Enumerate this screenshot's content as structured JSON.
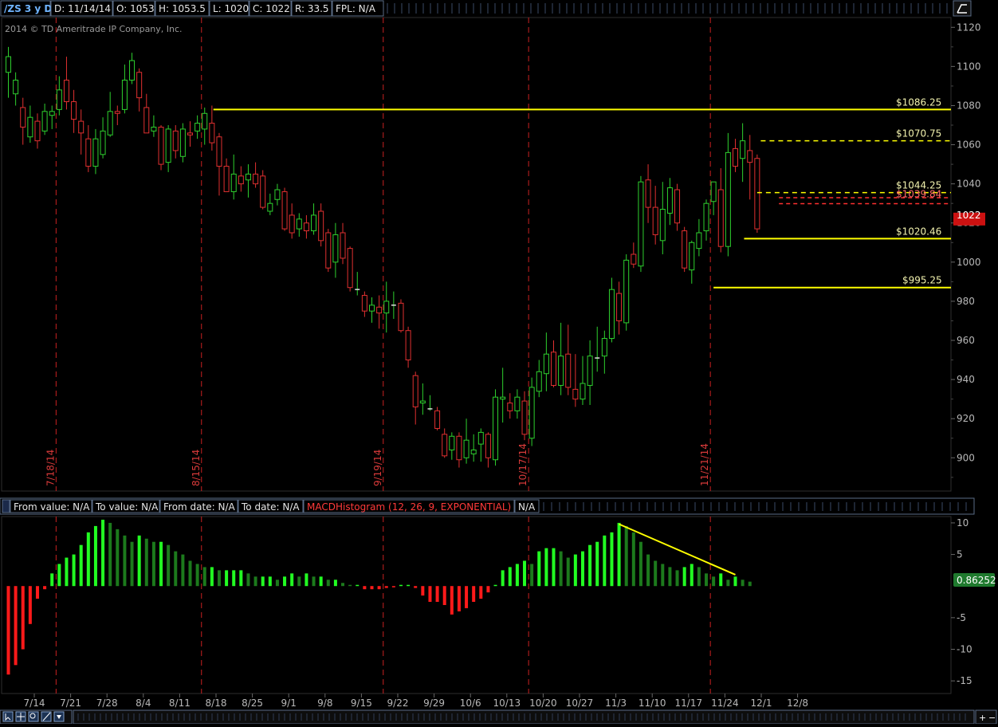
{
  "header": {
    "symbol": "/ZS 3 y D",
    "date": "D: 11/14/14",
    "open": "O: 1053",
    "high": "H: 1053.5",
    "low": "L: 1020",
    "close": "C: 1022",
    "range": "R: 33.5",
    "fpl": "FPL: N/A"
  },
  "copyright": "2014 © TD Ameritrade IP Company, Inc.",
  "last_price_label": "1022",
  "macd_value_label": "0.86252",
  "study_bar": {
    "from_value": "From value: N/A",
    "to_value": "To value: N/A",
    "from_date": "From date: N/A",
    "to_date": "To date: N/A",
    "study_name": "MACDHistogram (12, 26, 9, EXPONENTIAL)",
    "study_value": "N/A"
  },
  "colors": {
    "up": "#2ed02e",
    "down": "#e03030",
    "level": "#ffff00",
    "pivot_red": "#ff3030",
    "grid_red": "#c82020",
    "hist_bright": "#22ff22",
    "hist_dark": "#1c7a1c",
    "hist_red": "#ff1a1a",
    "last_price_bg": "#cc1111",
    "macd_bg": "#1f7a2e"
  },
  "chart_data": [
    {
      "type": "candlestick",
      "title": "/ZS 3 y D",
      "ylim": [
        883,
        1125
      ],
      "yticks": [
        900,
        920,
        940,
        960,
        980,
        1000,
        1020,
        1040,
        1060,
        1080,
        1100,
        1120
      ],
      "xtick_labels": [
        "7/14",
        "7/21",
        "7/28",
        "8/4",
        "8/11",
        "8/18",
        "8/25",
        "9/1",
        "9/8",
        "9/15",
        "9/22",
        "9/29",
        "10/6",
        "10/13",
        "10/20",
        "10/27",
        "11/3",
        "11/10",
        "11/17",
        "11/24",
        "12/1",
        "12/8"
      ],
      "vertical_markers": [
        "7/18/14",
        "8/15/14",
        "9/19/14",
        "10/17/14",
        "11/21/14"
      ],
      "price_levels": [
        {
          "label": "$1086.25",
          "value": 1078,
          "style": "solid"
        },
        {
          "label": "$1070.75",
          "value": 1062,
          "style": "dashed"
        },
        {
          "label": "$1044.25",
          "value": 1035.5,
          "style": "dashed"
        },
        {
          "label": "$1039.84",
          "value": 1031.5,
          "style": "pivot"
        },
        {
          "label": "$1020.46",
          "value": 1012,
          "style": "solid"
        },
        {
          "label": "$995.25",
          "value": 987,
          "style": "solid"
        }
      ],
      "last_price": 1022,
      "candles": [
        [
          1097,
          1105,
          1084,
          1110
        ],
        [
          1086,
          1093,
          1080,
          1097
        ],
        [
          1079,
          1069,
          1060,
          1084
        ],
        [
          1064,
          1074,
          1061,
          1080
        ],
        [
          1072,
          1062,
          1058,
          1076
        ],
        [
          1067,
          1077,
          1065,
          1081
        ],
        [
          1075,
          1077,
          1068,
          1080
        ],
        [
          1078,
          1088,
          1075,
          1095
        ],
        [
          1093,
          1082,
          1078,
          1105
        ],
        [
          1082,
          1073,
          1066,
          1088
        ],
        [
          1072,
          1066,
          1055,
          1078
        ],
        [
          1063,
          1049,
          1046,
          1070
        ],
        [
          1049,
          1063,
          1045,
          1068
        ],
        [
          1055,
          1067,
          1053,
          1074
        ],
        [
          1065,
          1077,
          1064,
          1087
        ],
        [
          1077,
          1076,
          1070,
          1080
        ],
        [
          1078,
          1093,
          1076,
          1101
        ],
        [
          1093,
          1103,
          1091,
          1107
        ],
        [
          1097,
          1084,
          1077,
          1099
        ],
        [
          1079,
          1066,
          1069,
          1086
        ],
        [
          1067,
          1069,
          1064,
          1075
        ],
        [
          1069,
          1050,
          1047,
          1070
        ],
        [
          1051,
          1068,
          1046,
          1070
        ],
        [
          1067,
          1057,
          1053,
          1070
        ],
        [
          1054,
          1068,
          1051,
          1071
        ],
        [
          1066,
          1065,
          1059,
          1072
        ],
        [
          1067,
          1071,
          1063,
          1075
        ],
        [
          1068,
          1076,
          1060,
          1079
        ],
        [
          1071,
          1061,
          1057,
          1080
        ],
        [
          1064,
          1049,
          1034,
          1066
        ],
        [
          1049,
          1036,
          1037,
          1053
        ],
        [
          1036,
          1045,
          1032,
          1055
        ],
        [
          1044,
          1040,
          1036,
          1049
        ],
        [
          1042,
          1045,
          1033,
          1050
        ],
        [
          1045,
          1040,
          1038,
          1051
        ],
        [
          1044,
          1028,
          1027,
          1047
        ],
        [
          1026,
          1030,
          1024,
          1035
        ],
        [
          1032,
          1037,
          1029,
          1040
        ],
        [
          1036,
          1017,
          1016,
          1038
        ],
        [
          1024,
          1015,
          1012,
          1030
        ],
        [
          1017,
          1022,
          1013,
          1025
        ],
        [
          1020,
          1016,
          1012,
          1024
        ],
        [
          1016,
          1024,
          1014,
          1030
        ],
        [
          1026,
          1011,
          1008,
          1030
        ],
        [
          1015,
          997,
          995,
          1017
        ],
        [
          1000,
          1014,
          992,
          1020
        ],
        [
          1015,
          1002,
          999,
          1020
        ],
        [
          1007,
          987,
          985,
          1008
        ],
        [
          986,
          986,
          983,
          995
        ],
        [
          983,
          975,
          972,
          985
        ],
        [
          975,
          978,
          969,
          982
        ],
        [
          977,
          974,
          966,
          983
        ],
        [
          974,
          980,
          964,
          990
        ],
        [
          978,
          978,
          971,
          985
        ],
        [
          979,
          965,
          964,
          981
        ],
        [
          965,
          950,
          946,
          967
        ],
        [
          942,
          926,
          917,
          944
        ],
        [
          928,
          929,
          922,
          938
        ],
        [
          925,
          925,
          924,
          932
        ],
        [
          924,
          915,
          914,
          926
        ],
        [
          912,
          901,
          900,
          915
        ],
        [
          904,
          911,
          899,
          913
        ],
        [
          911,
          899,
          895,
          913
        ],
        [
          900,
          909,
          897,
          920
        ],
        [
          902,
          904,
          898,
          912
        ],
        [
          907,
          913,
          898,
          915
        ],
        [
          912,
          900,
          895,
          913
        ],
        [
          899,
          931,
          896,
          935
        ],
        [
          930,
          931,
          918,
          946
        ],
        [
          928,
          924,
          920,
          933
        ],
        [
          924,
          931,
          920,
          935
        ],
        [
          929,
          912,
          909,
          934
        ],
        [
          910,
          936,
          906,
          941
        ],
        [
          934,
          944,
          931,
          950
        ],
        [
          943,
          953,
          934,
          964
        ],
        [
          954,
          937,
          936,
          960
        ],
        [
          937,
          952,
          932,
          969
        ],
        [
          953,
          936,
          932,
          968
        ],
        [
          935,
          930,
          926,
          953
        ],
        [
          930,
          938,
          927,
          952
        ],
        [
          937,
          952,
          927,
          960
        ],
        [
          951,
          951,
          944,
          967
        ],
        [
          952,
          961,
          943,
          965
        ],
        [
          961,
          986,
          959,
          992
        ],
        [
          984,
          970,
          963,
          990
        ],
        [
          969,
          1001,
          965,
          1004
        ],
        [
          1004,
          999,
          997,
          1010
        ],
        [
          998,
          1041,
          995,
          1044
        ],
        [
          1042,
          1028,
          1020,
          1050
        ],
        [
          1028,
          1014,
          1009,
          1039
        ],
        [
          1011,
          1027,
          1004,
          1041
        ],
        [
          1025,
          1038,
          1019,
          1043
        ],
        [
          1037,
          1020,
          1016,
          1040
        ],
        [
          1016,
          997,
          995,
          1018
        ],
        [
          996,
          1010,
          989,
          1011
        ],
        [
          1007,
          1015,
          1003,
          1022
        ],
        [
          1016,
          1030,
          1011,
          1032
        ],
        [
          1031,
          1041,
          1024,
          1038
        ],
        [
          1037,
          1008,
          1005,
          1048
        ],
        [
          1008,
          1056,
          1003,
          1066
        ],
        [
          1058,
          1049,
          1046,
          1063
        ],
        [
          1053,
          1062,
          1041,
          1071
        ],
        [
          1057,
          1051,
          1032,
          1065
        ],
        [
          1053,
          1017,
          1015,
          1055
        ]
      ]
    },
    {
      "type": "bar",
      "title": "MACDHistogram (12, 26, 9, EXPONENTIAL)",
      "ylim": [
        -17,
        11
      ],
      "yticks": [
        -15,
        -10,
        -5,
        5,
        10
      ],
      "values": [
        -14,
        -12.5,
        -10,
        -6,
        -2,
        -0.5,
        2,
        3.5,
        4.5,
        5,
        6.5,
        8.5,
        9.5,
        10.5,
        10,
        9,
        8,
        7,
        8,
        7.5,
        7,
        7,
        6.5,
        5.5,
        5,
        4,
        3.5,
        3,
        3,
        2.5,
        2.5,
        2.5,
        2.5,
        2,
        1.5,
        1.5,
        1.5,
        1,
        1.5,
        2,
        1.5,
        2,
        1.5,
        1.5,
        1,
        1,
        0.5,
        0,
        0,
        -0.5,
        -0.5,
        -0.5,
        -0.3,
        -0.2,
        0,
        0,
        -0.3,
        -1.5,
        -2.5,
        -2.5,
        -3,
        -4.5,
        -4,
        -3.5,
        -2.5,
        -2,
        -1,
        0,
        2.5,
        3,
        3.5,
        4,
        3.5,
        5.5,
        6,
        6,
        5.5,
        4.5,
        5,
        5.5,
        6.5,
        7,
        8,
        8.5,
        10,
        9.5,
        8.5,
        7,
        5,
        4,
        3.5,
        3,
        2.5,
        3,
        3.5,
        3,
        2,
        1.5,
        2,
        1,
        1.5,
        1,
        0.7
      ],
      "trendline": {
        "from_index": 84,
        "from_value": 9.8,
        "to_index": 100,
        "to_value": 1.8
      }
    }
  ]
}
